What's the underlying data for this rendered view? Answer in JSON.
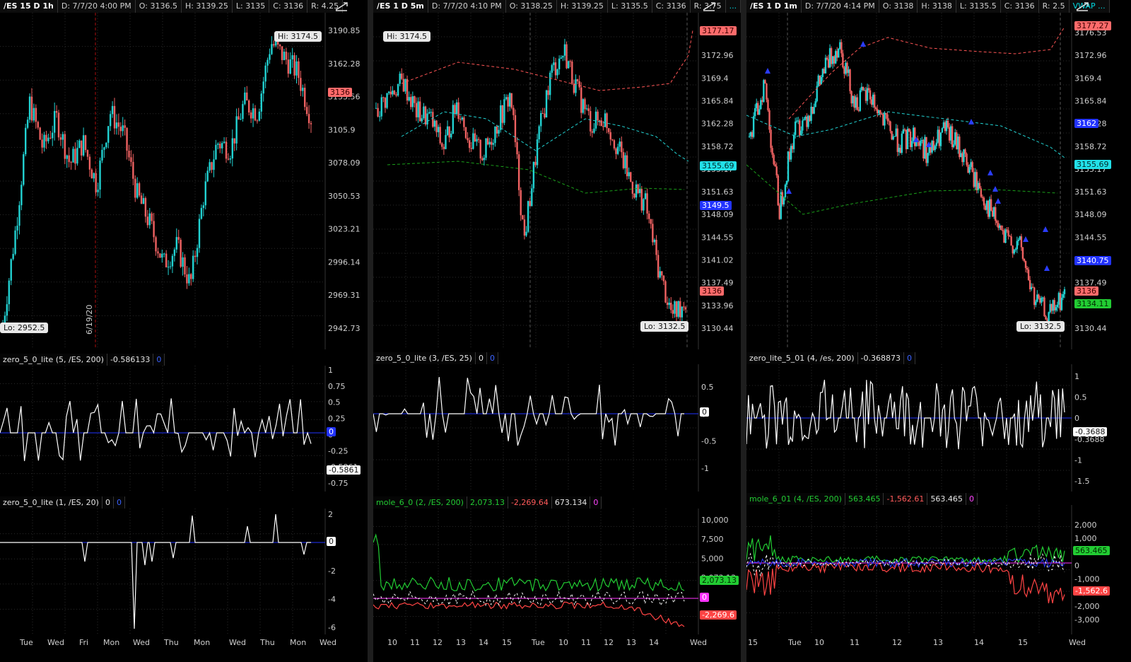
{
  "panels": [
    {
      "id": "p1",
      "header": [
        "/ES 15 D 1h",
        "D: 7/7/20 4:00 PM",
        "O: 3136.5",
        "H: 3139.25",
        "L: 3135",
        "C: 3136",
        "R: 4.25"
      ],
      "price_ticks": [
        "3190.85",
        "3162.28",
        "3133.56",
        "3105.9",
        "3078.09",
        "3050.53",
        "3023.21",
        "2996.14",
        "2969.31",
        "2942.73"
      ],
      "hi_label": "Hi: 3174.5",
      "lo_label": "Lo: 2952.5",
      "price_tags": [
        {
          "text": "3136",
          "bg": "#ff6b6b",
          "fg": "#3a0000"
        }
      ],
      "date_marker": "6/19/20",
      "sub1": {
        "parts": [
          "zero_5_0_lite (5, /ES, 200)",
          "-0.586133",
          "0"
        ],
        "ticks": [
          "1",
          "0.75",
          "0.5",
          "0.25",
          "0",
          "-0.25",
          "-0.5861",
          "-0.75"
        ]
      },
      "sub2": {
        "parts": [
          "zero_5_0_lite (1, /ES, 20)",
          "0",
          "0"
        ],
        "ticks": [
          "2",
          "0",
          "-2",
          "-4",
          "-6"
        ]
      },
      "x_labels": [
        "Tue",
        "Wed",
        "Fri",
        "Mon",
        "Wed",
        "Thu",
        "Mon",
        "Wed",
        "Thu",
        "Mon",
        "Wed"
      ]
    },
    {
      "id": "p2",
      "header": [
        "/ES 1 D 5m",
        "D: 7/7/20 4:10 PM",
        "O: 3138.25",
        "H: 3139.25",
        "L: 3135.5",
        "C: 3136",
        "R: 3.75",
        "..."
      ],
      "price_ticks": [
        "3176.53",
        "3172.96",
        "3169.4",
        "3165.84",
        "3162.28",
        "3158.72",
        "3155.17",
        "3151.63",
        "3148.09",
        "3144.55",
        "3141.02",
        "3137.49",
        "3133.96",
        "3130.44"
      ],
      "hi_label": "Hi: 3174.5",
      "lo_label": "Lo: 3132.5",
      "price_tags": [
        {
          "text": "3177.17",
          "bg": "#ff6b6b",
          "fg": "#3a0000"
        },
        {
          "text": "3155.69",
          "bg": "#22e0e8",
          "fg": "#002a2c"
        },
        {
          "text": "3149.5",
          "bg": "#2233ff",
          "fg": "#ffffff"
        },
        {
          "text": "3136",
          "bg": "#ff6b6b",
          "fg": "#3a0000"
        }
      ],
      "sub1": {
        "parts": [
          "zero_5_0_lite (3, /ES, 25)",
          "0",
          "0"
        ],
        "ticks": [
          "0.5",
          "0",
          "-0.5",
          "-1"
        ]
      },
      "sub2": {
        "parts": [
          "mole_6_0 (2, /ES, 200)",
          "2,073.13",
          "-2,269.64",
          "673.134",
          "0"
        ],
        "ticks": [
          "10,000",
          "7,500",
          "5,000",
          "2,073.13",
          "0",
          "-2,269.6"
        ]
      },
      "x_labels": [
        "10",
        "11",
        "12",
        "13",
        "14",
        "15",
        "Tue",
        "10",
        "11",
        "12",
        "13",
        "14",
        "Wed"
      ]
    },
    {
      "id": "p3",
      "header": [
        "/ES 1 D 1m",
        "D: 7/7/20 4:14 PM",
        "O: 3138",
        "H: 3138",
        "L: 3135.5",
        "C: 3136",
        "R: 2.5",
        "VWAP ..."
      ],
      "price_ticks": [
        "3176.53",
        "3172.96",
        "3169.4",
        "3165.84",
        "3162.28",
        "3158.72",
        "3155.17",
        "3151.63",
        "3148.09",
        "3144.55",
        "3141.02",
        "3137.49",
        "3133.96",
        "3130.44"
      ],
      "lo_label": "Lo: 3132.5",
      "price_tags": [
        {
          "text": "3177.27",
          "bg": "#ff6b6b",
          "fg": "#3a0000"
        },
        {
          "text": "3162",
          "bg": "#2233ff",
          "fg": "#ffffff"
        },
        {
          "text": "3155.69",
          "bg": "#22e0e8",
          "fg": "#002a2c"
        },
        {
          "text": "3140.75",
          "bg": "#2233ff",
          "fg": "#ffffff"
        },
        {
          "text": "3136",
          "bg": "#ff6b6b",
          "fg": "#3a0000"
        },
        {
          "text": "3134.11",
          "bg": "#22cc33",
          "fg": "#002a00"
        }
      ],
      "sub1": {
        "parts": [
          "zero_lite_5_01 (4, /es, 200)",
          "-0.368873",
          "0"
        ],
        "ticks": [
          "1",
          "0.5",
          "0",
          "-0.3688",
          "-1",
          "-1.5"
        ]
      },
      "sub2": {
        "parts": [
          "mole_6_01 (4, /ES, 200)",
          "563.465",
          "-1,562.61",
          "563.465",
          "0"
        ],
        "ticks": [
          "2,000",
          "1,000",
          "563.465",
          "0",
          "-1,000",
          "-1,562.6",
          "-2,000",
          "-3,000"
        ]
      },
      "x_labels": [
        "15",
        "Tue",
        "10",
        "11",
        "12",
        "13",
        "14",
        "15",
        "Wed"
      ]
    }
  ],
  "colors": {
    "up": "#22d3d3",
    "down": "#f06262",
    "zero_line": "#2233ff",
    "osc": "#ffffff",
    "green": "#22cc33",
    "red": "#ff4444",
    "magenta": "#ff33ff",
    "vwap": "#22d3d3",
    "bands_red": "#ff5555",
    "bands_green": "#1aa01a"
  }
}
